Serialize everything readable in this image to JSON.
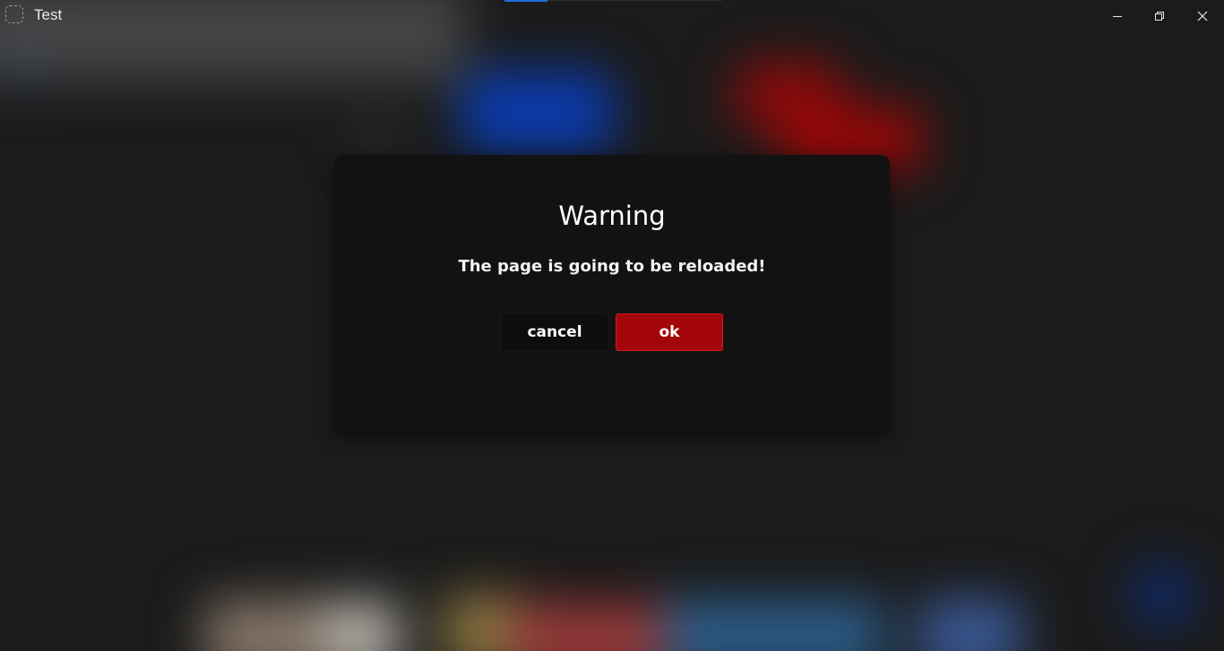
{
  "window": {
    "title": "Test",
    "app_icon": "dashed-square-icon",
    "controls": {
      "minimize_icon": "minimize-icon",
      "maximize_icon": "restore-icon",
      "close_icon": "close-icon"
    }
  },
  "dialog": {
    "title": "Warning",
    "message": "The page is going to be reloaded!",
    "cancel_label": "cancel",
    "ok_label": "ok"
  },
  "colors": {
    "ok_button": "#a2050a",
    "ok_border": "#d11a1f",
    "dialog_bg": "#121212",
    "tab_indicator": "#1d6fd8"
  }
}
